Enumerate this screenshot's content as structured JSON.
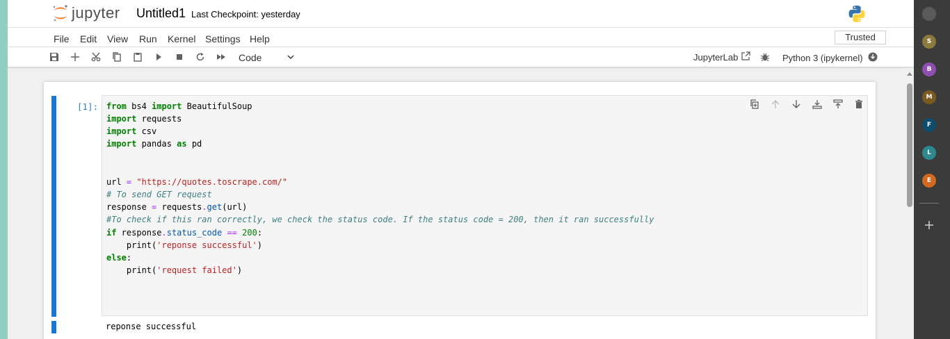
{
  "header": {
    "logo_text": "jupyter",
    "notebook_title": "Untitled1",
    "checkpoint": "Last Checkpoint: yesterday"
  },
  "menu": {
    "items": [
      "File",
      "Edit",
      "View",
      "Run",
      "Kernel",
      "Settings",
      "Help"
    ],
    "trusted": "Trusted"
  },
  "toolbar": {
    "cell_type": "Code",
    "jupyterlab_link": "JupyterLab",
    "kernel_name": "Python 3 (ipykernel)",
    "icons": [
      "save-icon",
      "add-icon",
      "cut-icon",
      "copy-icon",
      "paste-icon",
      "run-icon",
      "stop-icon",
      "restart-icon",
      "fast-forward-icon"
    ]
  },
  "cell": {
    "prompt": "[1]:",
    "code_lines": [
      "from bs4 import BeautifulSoup",
      "import requests",
      "import csv",
      "import pandas as pd",
      "",
      "",
      "url = \"https://quotes.toscrape.com/\"",
      "# To send GET request",
      "response = requests.get(url)",
      "#To check if this ran correctly, we check the status code. If the status code = 200, then it ran successfully",
      "if response.status_code == 200:",
      "    print('reponse successful')",
      "else:",
      "    print('request failed')"
    ],
    "output": "reponse successful",
    "toolbar_icons": [
      "duplicate-icon",
      "move-up-icon",
      "move-down-icon",
      "insert-below-icon",
      "insert-above-icon",
      "delete-icon"
    ]
  },
  "sidebar": {
    "avatars": [
      {
        "initial": "",
        "color": "#5a5a5a"
      },
      {
        "initial": "S",
        "color": "#8a7a3c"
      },
      {
        "initial": "B",
        "color": "#8e4fb0"
      },
      {
        "initial": "M",
        "color": "#7a5a1e"
      },
      {
        "initial": "F",
        "color": "#0e4c6e"
      },
      {
        "initial": "L",
        "color": "#2b8a8f"
      },
      {
        "initial": "E",
        "color": "#d2691e"
      }
    ]
  },
  "colors": {
    "accent": "#1976d2",
    "prompt": "#307fc1",
    "keyword": "#008000",
    "string": "#ba2121",
    "comment": "#408080"
  }
}
